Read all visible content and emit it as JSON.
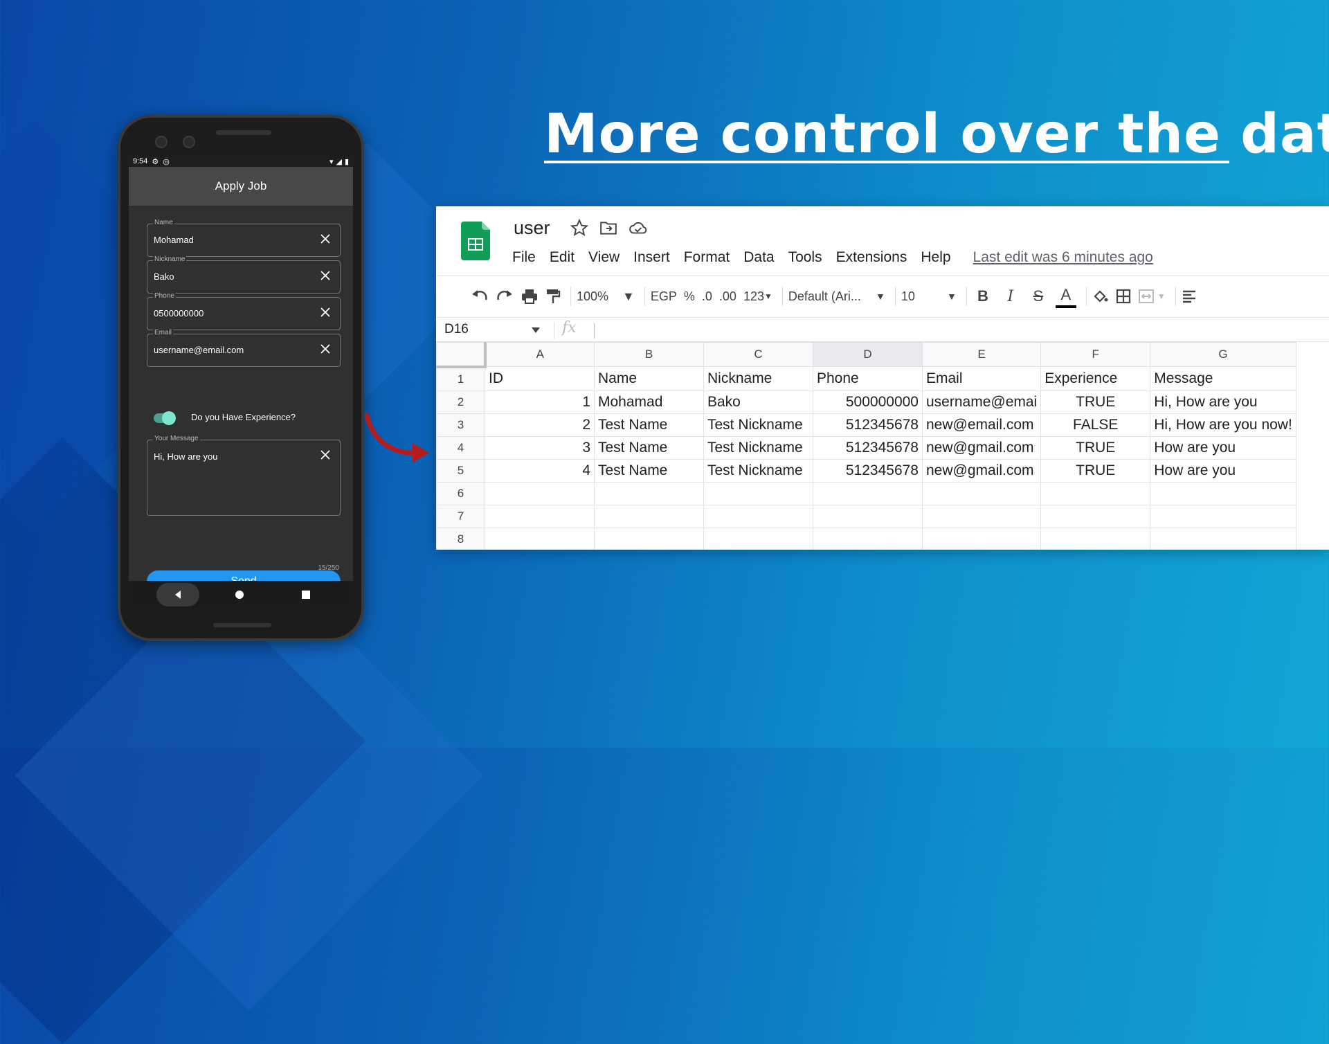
{
  "headline": "More control over the data",
  "phone": {
    "status_time": "9:54",
    "app_title": "Apply Job",
    "fields": [
      {
        "label": "Name",
        "value": "Mohamad"
      },
      {
        "label": "Nickname",
        "value": "Bako"
      },
      {
        "label": "Phone",
        "value": "0500000000"
      },
      {
        "label": "Email",
        "value": "username@email.com"
      }
    ],
    "experience_label": "Do you Have Experience?",
    "experience_on": true,
    "message_label": "Your Message",
    "message_value": "Hi, How are you",
    "counter": "15/250",
    "send_label": "Send"
  },
  "sheets": {
    "doc_title": "user",
    "menu": [
      "File",
      "Edit",
      "View",
      "Insert",
      "Format",
      "Data",
      "Tools",
      "Extensions",
      "Help"
    ],
    "last_edit": "Last edit was 6 minutes ago",
    "toolbar": {
      "zoom": "100%",
      "currency": "EGP",
      "percent": "%",
      "decrease_decimal": ".0",
      "increase_decimal": ".00",
      "more_formats": "123",
      "font": "Default (Ari...",
      "font_size": "10",
      "bold": "B",
      "italic": "I",
      "strike": "S",
      "text_color": "A"
    },
    "name_box": "D16",
    "fx": "fx",
    "columns": [
      "A",
      "B",
      "C",
      "D",
      "E",
      "F",
      "G"
    ],
    "selected_column": "D",
    "rows": [
      [
        "1",
        "ID",
        "Name",
        "Nickname",
        "Phone",
        "Email",
        "Experience",
        "Message"
      ],
      [
        "2",
        "1",
        "Mohamad",
        "Bako",
        "500000000",
        "username@emai",
        "TRUE",
        "Hi, How are you"
      ],
      [
        "3",
        "2",
        "Test Name",
        "Test Nickname",
        "512345678",
        "new@email.com",
        "FALSE",
        "Hi, How are you now!"
      ],
      [
        "4",
        "3",
        "Test Name",
        "Test Nickname",
        "512345678",
        "new@gmail.com",
        "TRUE",
        "How are you"
      ],
      [
        "5",
        "4",
        "Test Name",
        "Test Nickname",
        "512345678",
        "new@gmail.com",
        "TRUE",
        "How are you"
      ],
      [
        "6",
        "",
        "",
        "",
        "",
        "",
        "",
        ""
      ],
      [
        "7",
        "",
        "",
        "",
        "",
        "",
        "",
        ""
      ],
      [
        "8",
        "",
        "",
        "",
        "",
        "",
        "",
        ""
      ]
    ]
  },
  "colors": {
    "accent_blue": "#2196f3",
    "toggle_green": "#7ee5cf",
    "sheets_green": "#0f9d58",
    "arrow_red": "#b71c1c"
  }
}
